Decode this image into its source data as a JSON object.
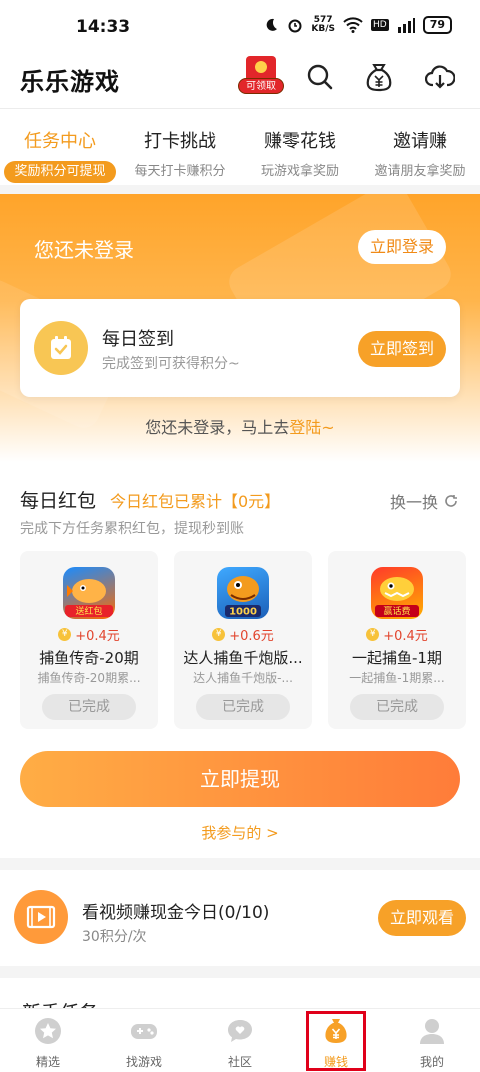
{
  "status_bar": {
    "time": "14:33",
    "net_speed_top": "577",
    "net_speed_unit": "KB/S",
    "battery": "79",
    "hd": "HD",
    "signal": "5G"
  },
  "header": {
    "title": "乐乐游戏",
    "redpacket_label": "可领取"
  },
  "tabs": [
    {
      "title": "任务中心",
      "subtitle": "奖励积分可提现"
    },
    {
      "title": "打卡挑战",
      "subtitle": "每天打卡赚积分"
    },
    {
      "title": "赚零花钱",
      "subtitle": "玩游戏拿奖励"
    },
    {
      "title": "邀请赚",
      "subtitle": "邀请朋友拿奖励"
    }
  ],
  "banner": {
    "not_logged": "您还未登录",
    "login_button": "立即登录",
    "sign_title": "每日签到",
    "sign_subtitle": "完成签到可获得积分~",
    "sign_button": "立即签到",
    "prompt_text": "您还未登录，马上去",
    "prompt_link": "登陆~"
  },
  "red_packet": {
    "title": "每日红包",
    "accum": "今日红包已累计【0元】",
    "switch": "换一换",
    "description": "完成下方任务累积红包，提现秒到账",
    "cards": [
      {
        "reward": "+0.4元",
        "name": "捕鱼传奇-20期",
        "sub": "捕鱼传奇-20期累...",
        "status": "已完成",
        "icon_text": "送红包"
      },
      {
        "reward": "+0.6元",
        "name": "达人捕鱼千炮版...",
        "sub": "达人捕鱼千炮版-...",
        "status": "已完成",
        "icon_text": "1000"
      },
      {
        "reward": "+0.4元",
        "name": "一起捕鱼-1期",
        "sub": "一起捕鱼-1期累...",
        "status": "已完成",
        "icon_text": "赢话费"
      }
    ],
    "withdraw_button": "立即提现",
    "my_participation": "我参与的 >"
  },
  "video_task": {
    "title": "看视频赚现金今日(0/10)",
    "subtitle": "30积分/次",
    "button": "立即观看"
  },
  "peek_title": "新手任务",
  "bottom_nav": [
    {
      "label": "精选"
    },
    {
      "label": "找游戏"
    },
    {
      "label": "社区"
    },
    {
      "label": "赚钱"
    },
    {
      "label": "我的"
    }
  ],
  "colors": {
    "accent": "#f39b1e",
    "highlight": "#e0001a"
  }
}
